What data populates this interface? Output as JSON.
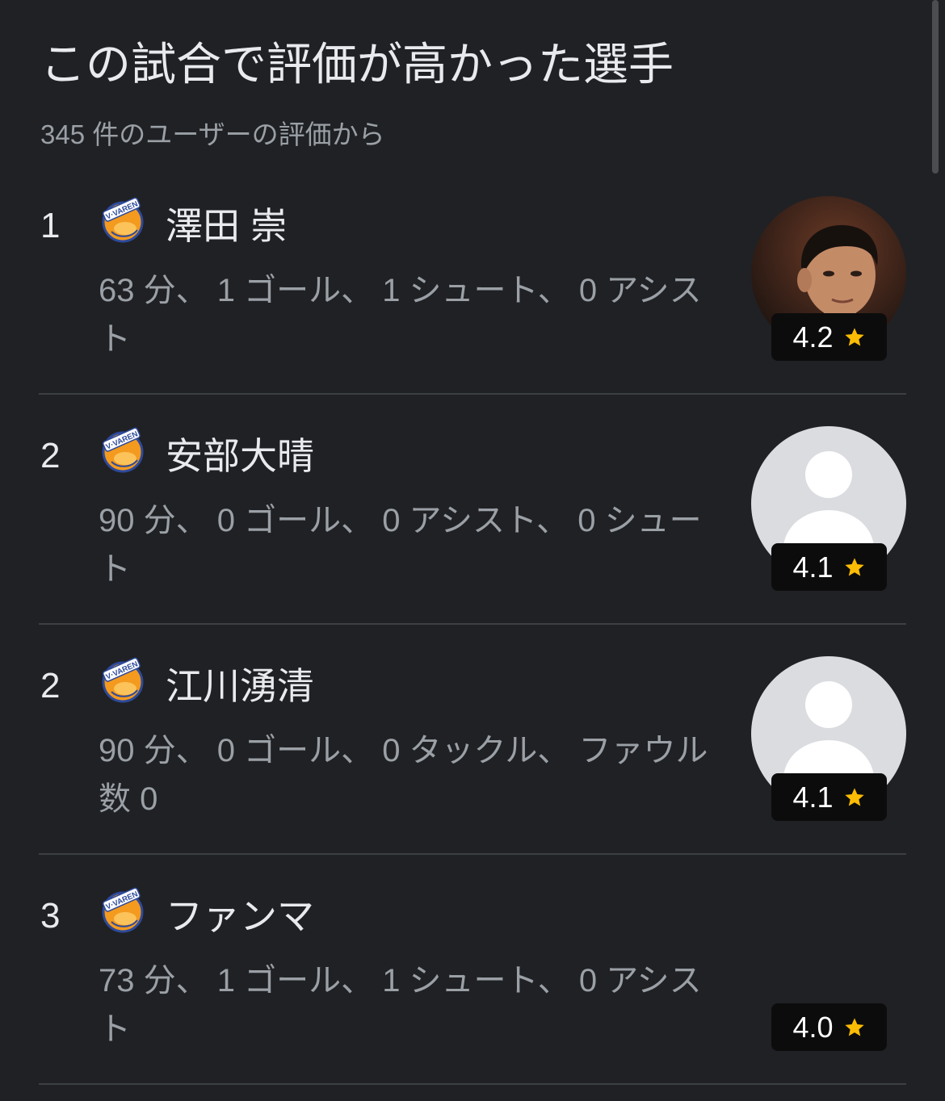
{
  "header": {
    "title": "この試合で評価が高かった選手",
    "subtitle": "345 件のユーザーの評価から"
  },
  "team": {
    "logo_icon": "v-varen-logo-icon",
    "logo_lettering": "V·VAREN"
  },
  "colors": {
    "background": "#202124",
    "text_primary": "#e8eaed",
    "text_secondary": "#9aa0a6",
    "divider": "#3c4043",
    "badge_background": "#0c0c0c",
    "star": "#fbbc04",
    "avatar_placeholder": "#dadce0"
  },
  "players": [
    {
      "rank": "1",
      "name": "澤田 崇",
      "stats": "63 分、 1 ゴール、 1 シュート、 0 アシスト",
      "rating": "4.2",
      "rating_icon": "star-icon",
      "avatar": "player-photo"
    },
    {
      "rank": "2",
      "name": "安部大晴",
      "stats": "90 分、 0 ゴール、 0 アシスト、 0 シュート",
      "rating": "4.1",
      "rating_icon": "star-icon",
      "avatar": "person-placeholder-icon"
    },
    {
      "rank": "2",
      "name": "江川湧清",
      "stats": "90 分、 0 ゴール、 0 タックル、 ファウル数 0",
      "rating": "4.1",
      "rating_icon": "star-icon",
      "avatar": "person-placeholder-icon"
    },
    {
      "rank": "3",
      "name": "ファンマ",
      "stats": "73 分、 1 ゴール、 1 シュート、 0 アシスト",
      "rating": "4.0",
      "rating_icon": "star-icon",
      "avatar": "none"
    }
  ]
}
